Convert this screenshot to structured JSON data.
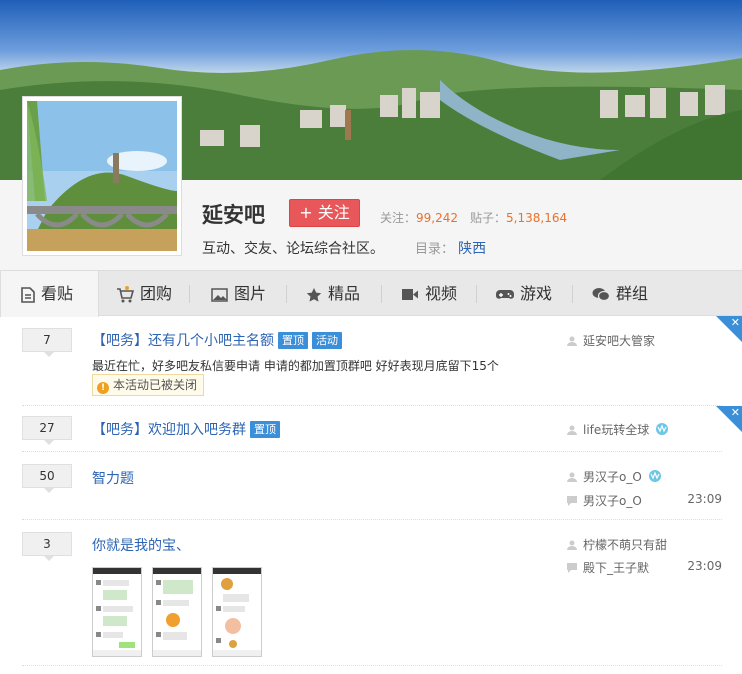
{
  "forum": {
    "name": "延安吧",
    "follow_label": "+ 关注",
    "followers_label": "关注：",
    "followers": "99,242",
    "posts_label": "贴子：",
    "posts": "5,138,164",
    "description": "互动、交友、论坛综合社区。",
    "catalog_label": "目录：",
    "catalog_value": "陕西"
  },
  "nav": {
    "items": [
      {
        "label": "看贴",
        "icon": "document-icon",
        "active": true
      },
      {
        "label": "团购",
        "icon": "cart-icon"
      },
      {
        "label": "图片",
        "icon": "image-icon"
      },
      {
        "label": "精品",
        "icon": "star-icon"
      },
      {
        "label": "视频",
        "icon": "video-icon"
      },
      {
        "label": "游戏",
        "icon": "gamepad-icon"
      },
      {
        "label": "群组",
        "icon": "chat-icon"
      }
    ]
  },
  "threads": [
    {
      "replies": "7",
      "title": "【吧务】还有几个小吧主名额",
      "tags": [
        "置顶",
        "活动"
      ],
      "excerpt": "最近在忙，好多吧友私信要申请 申请的都加置顶群吧 好好表现月底留下15个",
      "closed_badge": "本活动已被关闭",
      "author": "延安吧大管家"
    },
    {
      "replies": "27",
      "title": "【吧务】欢迎加入吧务群",
      "tags": [
        "置顶"
      ],
      "author": "life玩转全球"
    },
    {
      "replies": "50",
      "title": "智力题",
      "author": "男汉子o_O",
      "last_replier": "男汉子o_O",
      "time": "23:09"
    },
    {
      "replies": "3",
      "title": "你就是我的宝、",
      "author": "柠檬不萌只有甜",
      "last_replier": "殿下_王子默",
      "time": "23:09"
    }
  ],
  "colors": {
    "accent": "#2d64b3",
    "follow": "#e8575a",
    "stat_number": "#e8722e",
    "tag": "#3b8ed8"
  }
}
